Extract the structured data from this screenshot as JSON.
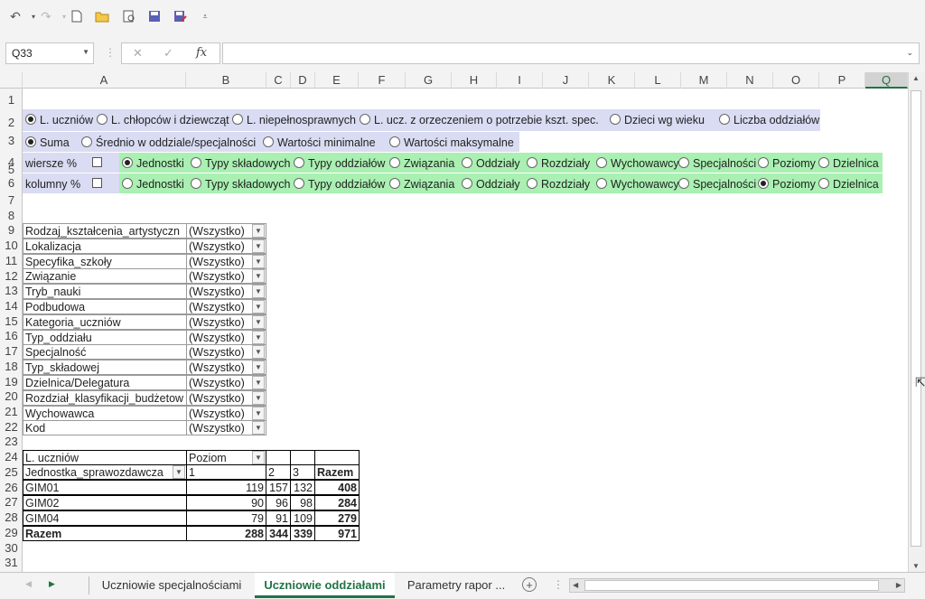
{
  "toolbar": {
    "buttons": [
      "undo-icon",
      "redo-icon",
      "new-file-icon",
      "open-folder-icon",
      "print-preview-icon",
      "save-icon",
      "save-as-icon",
      "customize-icon"
    ]
  },
  "formula_bar": {
    "name_box": "Q33",
    "cancel": "✕",
    "enter": "✓",
    "fx": "fx",
    "formula": ""
  },
  "columns": [
    "A",
    "B",
    "C",
    "D",
    "E",
    "F",
    "G",
    "H",
    "I",
    "J",
    "K",
    "L",
    "M",
    "N",
    "O",
    "P",
    "Q"
  ],
  "selected_column": "Q",
  "rows": [
    "1",
    "2",
    "3",
    "4",
    "5",
    "6",
    "7",
    "8",
    "9",
    "10",
    "11",
    "12",
    "13",
    "14",
    "15",
    "16",
    "17",
    "18",
    "19",
    "20",
    "21",
    "22",
    "23",
    "24",
    "25",
    "26",
    "27",
    "28",
    "29",
    "30",
    "31"
  ],
  "measure_options": [
    {
      "label": "L. uczniów",
      "selected": true
    },
    {
      "label": "L. chłopców  i dziewcząt",
      "selected": false
    },
    {
      "label": "L.  niepełnosprawnych",
      "selected": false
    },
    {
      "label": "L. ucz.  z  orzeczeniem o potrzebie  kszt. spec.",
      "selected": false
    },
    {
      "label": "Dzieci wg wieku",
      "selected": false
    },
    {
      "label": "Liczba oddziałów",
      "selected": false
    }
  ],
  "aggregate_options": [
    {
      "label": "Suma",
      "selected": true
    },
    {
      "label": "Średnio w  oddziale/specjalności",
      "selected": false
    },
    {
      "label": "Wartości  minimalne",
      "selected": false
    },
    {
      "label": "Wartości  maksymalne",
      "selected": false
    }
  ],
  "rows_pct_label": "wiersze %",
  "cols_pct_label": "kolumny %",
  "dimension_options": [
    "Jednostki",
    "Typy składowych",
    "Typy oddziałów",
    "Związania",
    "Oddziały",
    "Rozdziały",
    "Wychowawcy",
    "Specjalności",
    "Poziomy",
    "Dzielnica"
  ],
  "rows_selected": "Jednostki",
  "cols_selected": "Poziomy",
  "filters": [
    {
      "field": "Rodzaj_kształcenia_artystyczn",
      "value": "(Wszystko)"
    },
    {
      "field": "Lokalizacja",
      "value": "(Wszystko)"
    },
    {
      "field": "Specyfika_szkoły",
      "value": "(Wszystko)"
    },
    {
      "field": "Związanie",
      "value": "(Wszystko)"
    },
    {
      "field": "Tryb_nauki",
      "value": "(Wszystko)"
    },
    {
      "field": "Podbudowa",
      "value": "(Wszystko)"
    },
    {
      "field": "Kategoria_uczniów",
      "value": "(Wszystko)"
    },
    {
      "field": "Typ_oddziału",
      "value": "(Wszystko)"
    },
    {
      "field": "Specjalność",
      "value": "(Wszystko)"
    },
    {
      "field": "Typ_składowej",
      "value": "(Wszystko)"
    },
    {
      "field": "Dzielnica/Delegatura",
      "value": "(Wszystko)"
    },
    {
      "field": "Rozdział_klasyfikacji_budżetow",
      "value": "(Wszystko)"
    },
    {
      "field": "Wychowawca",
      "value": "(Wszystko)"
    },
    {
      "field": "Kod",
      "value": "(Wszystko)"
    }
  ],
  "pivot": {
    "measure": "L. uczniów",
    "col_field": "Poziom",
    "row_field": "Jednostka_sprawozdawcza",
    "col_headers": [
      "1",
      "2",
      "3",
      "Razem"
    ],
    "rows": [
      {
        "label": "GIM01",
        "values": [
          "119",
          "157",
          "132",
          "408"
        ]
      },
      {
        "label": "GIM02",
        "values": [
          "90",
          "96",
          "98",
          "284"
        ]
      },
      {
        "label": "GIM04",
        "values": [
          "79",
          "91",
          "109",
          "279"
        ]
      }
    ],
    "total": {
      "label": "Razem",
      "values": [
        "288",
        "344",
        "339",
        "971"
      ]
    }
  },
  "sheet_tabs": [
    "Uczniowie specjalnościami",
    "Uczniowie oddziałami",
    "Parametry rapor ..."
  ],
  "active_tab": "Uczniowie oddziałami"
}
